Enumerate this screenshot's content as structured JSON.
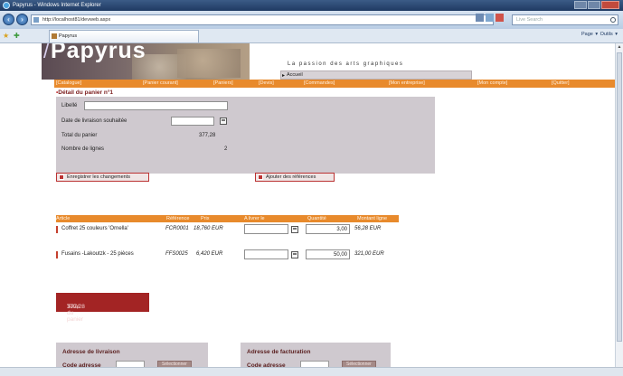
{
  "browser": {
    "window_title": "Papyrus - Windows Internet Explorer",
    "address": "http://localhost81/devweb.aspx",
    "search_placeholder": "Live Search",
    "tab_title": "Papyrus",
    "command_bar": "Page ▾  Outils ▾"
  },
  "site": {
    "logo": "Papyrus",
    "tagline": "La passion des arts graphiques",
    "breadcrumb": "Accueil",
    "menu": [
      {
        "label": "[Catalogue]"
      },
      {
        "label": "[Panier courant]"
      },
      {
        "label": "[Paniers]"
      },
      {
        "label": "[Devis]"
      },
      {
        "label": "[Commandes]"
      },
      {
        "label": "[Mon entreprise]"
      },
      {
        "label": "[Mon compte]"
      },
      {
        "label": "[Quitter]"
      }
    ]
  },
  "cart": {
    "title": "Détail du panier n°1",
    "bullet": "•",
    "label_libelle": "Libellé",
    "libelle_value": "",
    "label_delivery": "Date de livraison souhaitée",
    "delivery_value": "",
    "label_total": "Total du panier",
    "total_value": "377,28",
    "label_lines": "Nombre de lignes",
    "lines_value": "2"
  },
  "actions": {
    "save_label": "Enregistrer les changements",
    "add_refs_label": "Ajouter des références"
  },
  "table": {
    "headers": [
      "Article",
      "Référence",
      "Prix",
      "A livrer le",
      "Quantité",
      "Montant ligne"
    ],
    "rows": [
      {
        "article": "Coffret 25 couleurs 'Ornella'",
        "reference": "FCR0001",
        "price": "18,760 EUR",
        "deliver_on": "",
        "quantity": "3,00",
        "amount": "56,28 EUR"
      },
      {
        "article": "Fusains -Lakoutzk - 25 pièces",
        "reference": "FFS0025",
        "price": "6,420 EUR",
        "deliver_on": "",
        "quantity": "50,00",
        "amount": "321,00 EUR"
      }
    ]
  },
  "total_box": {
    "label": "Total du panier",
    "value": "377,28"
  },
  "delivery_address": {
    "heading": "Adresse de livraison",
    "code_label": "Code adresse",
    "code_value": "",
    "select_label": "Sélectionner"
  },
  "billing_address": {
    "heading": "Adresse de facturation",
    "code_label": "Code adresse",
    "code_value": "",
    "select_label": "Sélectionner"
  },
  "colors": {
    "menu_orange": "#e88a2c",
    "panel_grey": "#cfc9cf",
    "total_red": "#a32424"
  }
}
